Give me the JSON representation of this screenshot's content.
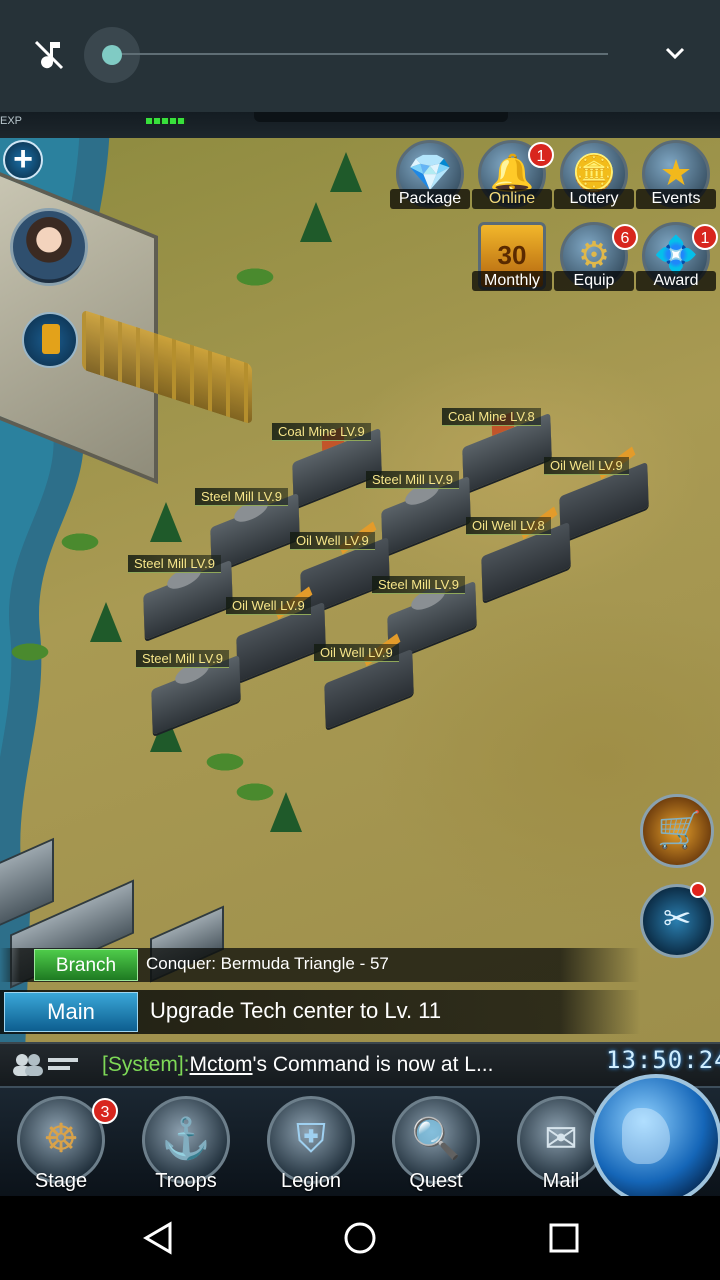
{
  "top_status": {
    "mute_icon": "music-off-icon",
    "chevron_icon": "chevron-down-icon",
    "volume_level": 0.0
  },
  "hud": {
    "exp_label": "EXP"
  },
  "top_icons": [
    {
      "label": "Package",
      "glyph": "💎",
      "badge": ""
    },
    {
      "label": "Online",
      "glyph": "🔔",
      "badge": "1"
    },
    {
      "label": "Lottery",
      "glyph": "🪙",
      "badge": ""
    },
    {
      "label": "Events",
      "glyph": "★",
      "badge": ""
    },
    {
      "label": "Monthly",
      "glyph": "30",
      "badge": ""
    },
    {
      "label": "Equip",
      "glyph": "⚙",
      "badge": "6"
    },
    {
      "label": "Award",
      "glyph": "💠",
      "badge": "1"
    }
  ],
  "buildings": [
    {
      "type": "coal",
      "label": "Coal Mine LV.9"
    },
    {
      "type": "coal",
      "label": "Coal Mine LV.8"
    },
    {
      "type": "oil",
      "label": "Oil Well LV.9"
    },
    {
      "type": "steel",
      "label": "Steel Mill LV.9"
    },
    {
      "type": "steel",
      "label": "Steel Mill LV.9"
    },
    {
      "type": "oil",
      "label": "Oil Well LV.8"
    },
    {
      "type": "oil",
      "label": "Oil Well LV.9"
    },
    {
      "type": "steel",
      "label": "Steel Mill LV.9"
    },
    {
      "type": "steel",
      "label": "Steel Mill LV.9"
    },
    {
      "type": "oil",
      "label": "Oil Well LV.9"
    },
    {
      "type": "steel",
      "label": "Steel Mill LV.9"
    },
    {
      "type": "oil",
      "label": "Oil Well LV.9"
    }
  ],
  "quests": {
    "branch_tag": "Branch",
    "branch_text": "Conquer: Bermuda Triangle - 57",
    "main_tag": "Main",
    "main_text": "Upgrade Tech center to Lv. 11"
  },
  "chat": {
    "channel": "[System]:",
    "user": "Mctom",
    "message": "'s Command is now at L...",
    "clock": "13:50:24"
  },
  "nav": [
    {
      "label": "Stage",
      "glyph": "☸",
      "badge": "3"
    },
    {
      "label": "Troops",
      "glyph": "⚓",
      "badge": ""
    },
    {
      "label": "Legion",
      "glyph": "⛨",
      "badge": ""
    },
    {
      "label": "Quest",
      "glyph": "🔍",
      "badge": ""
    },
    {
      "label": "Mail",
      "glyph": "✉",
      "badge": ""
    }
  ]
}
